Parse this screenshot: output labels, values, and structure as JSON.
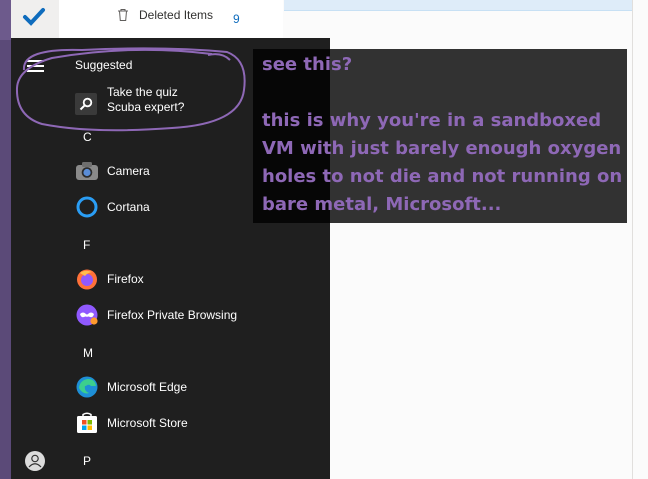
{
  "outlook": {
    "folder_deleted": "Deleted Items",
    "folder_deleted_count": "9"
  },
  "start_menu": {
    "suggested_heading": "Suggested",
    "suggestion": {
      "line1": "Take the quiz",
      "line2": "Scuba expert?"
    },
    "letters": [
      "C",
      "F",
      "M",
      "P"
    ],
    "apps": [
      {
        "label": "Camera",
        "icon": "camera-icon"
      },
      {
        "label": "Cortana",
        "icon": "cortana-icon"
      },
      {
        "label": "Firefox",
        "icon": "firefox-icon"
      },
      {
        "label": "Firefox Private Browsing",
        "icon": "firefox-private-icon"
      },
      {
        "label": "Microsoft Edge",
        "icon": "edge-icon"
      },
      {
        "label": "Microsoft Store",
        "icon": "store-icon"
      }
    ]
  },
  "annotation": {
    "line1": "see this?",
    "line2": "this is why you're in a sandboxed VM with just barely enough oxygen holes to not die and not running on bare metal, Microsoft..."
  },
  "colors": {
    "annotation_text": "#8e68b6",
    "start_bg": "#1f1f1f",
    "accent_blue": "#0f6cbd"
  }
}
